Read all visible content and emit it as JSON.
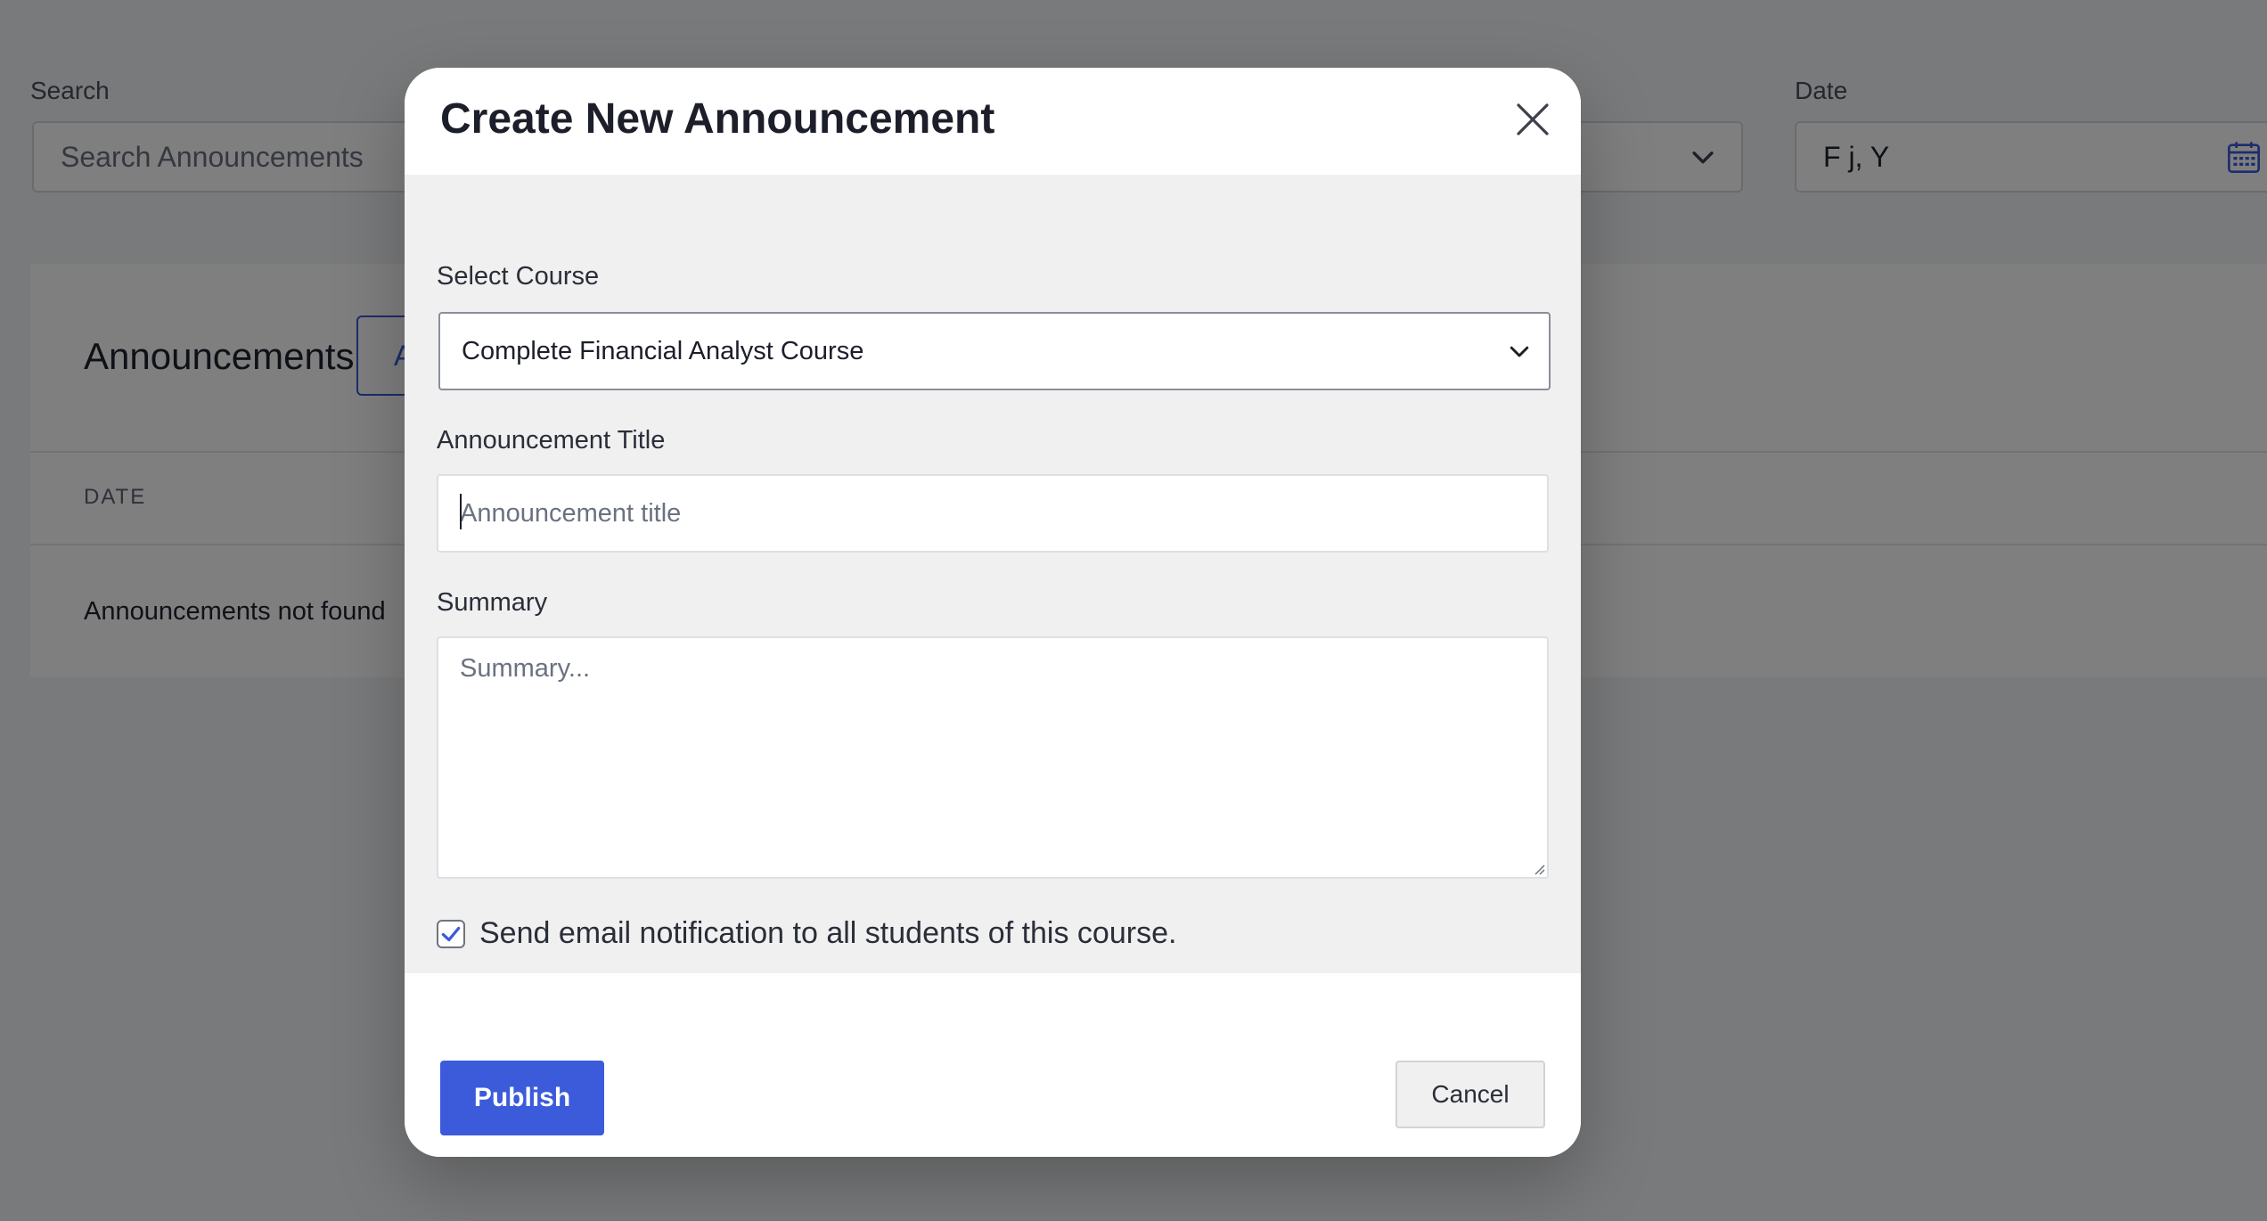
{
  "background": {
    "search": {
      "label": "Search",
      "placeholder": "Search Announcements"
    },
    "date": {
      "label": "Date",
      "value": "F j, Y"
    },
    "panel": {
      "title": "Announcements",
      "add_button_label": "A",
      "column_date": "DATE",
      "empty_message": "Announcements not found"
    }
  },
  "modal": {
    "title": "Create New Announcement",
    "course": {
      "label": "Select Course",
      "selected": "Complete Financial Analyst Course"
    },
    "announcement_title": {
      "label": "Announcement Title",
      "placeholder": "Announcement title",
      "value": ""
    },
    "summary": {
      "label": "Summary",
      "placeholder": "Summary...",
      "value": ""
    },
    "notify": {
      "label": "Send email notification to all students of this course.",
      "checked": true
    },
    "publish_label": "Publish",
    "cancel_label": "Cancel"
  },
  "colors": {
    "accent": "#3b5bdb",
    "overlay": "rgba(0,0,0,0.5)",
    "modal_body_bg": "#f0f0f0"
  },
  "icons": {
    "close": "close-icon",
    "select_chevron": "chevron-down-icon",
    "date_picker": "calendar-icon",
    "checkbox_mark": "checkmark-icon"
  }
}
